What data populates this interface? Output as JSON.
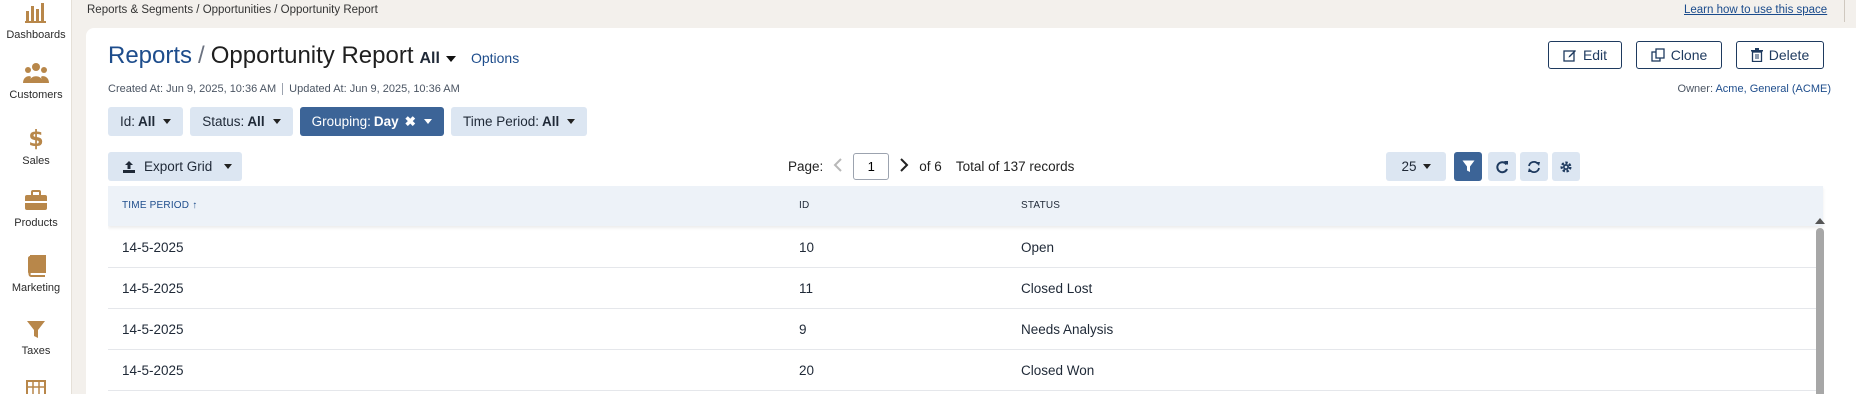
{
  "sidebar": {
    "items": [
      {
        "label": "Dashboards",
        "icon": "bar-chart-icon"
      },
      {
        "label": "Customers",
        "icon": "users-icon"
      },
      {
        "label": "Sales",
        "icon": "dollar-icon"
      },
      {
        "label": "Products",
        "icon": "briefcase-icon"
      },
      {
        "label": "Marketing",
        "icon": "book-icon"
      },
      {
        "label": "Taxes",
        "icon": "filter-icon"
      }
    ],
    "icon_color": "#b8874a"
  },
  "topbar": {
    "breadcrumb": "Reports & Segments / Opportunities / Opportunity Report",
    "learn_link": "Learn how to use this space"
  },
  "header": {
    "root": "Reports",
    "separator": "/",
    "title": "Opportunity Report",
    "view": "All",
    "options": "Options",
    "created": "Created At: Jun 9, 2025, 10:36 AM",
    "updated": "Updated At: Jun 9, 2025, 10:36 AM",
    "owner_label": "Owner:",
    "owner_value": "Acme, General (ACME)",
    "edit": "Edit",
    "clone": "Clone",
    "delete": "Delete"
  },
  "filters": [
    {
      "name": "Id:",
      "value": "All"
    },
    {
      "name": "Status:",
      "value": "All"
    },
    {
      "name": "Grouping:",
      "value": "Day"
    },
    {
      "name": "Time Period:",
      "value": "All"
    }
  ],
  "toolbar": {
    "export": "Export Grid",
    "page_label": "Page:",
    "page_value": "1",
    "page_of": "of 6",
    "total": "Total of 137 records",
    "per_page": "25"
  },
  "grid": {
    "columns": [
      "TIME PERIOD",
      "ID",
      "STATUS"
    ],
    "rows": [
      [
        "14-5-2025",
        "10",
        "Open"
      ],
      [
        "14-5-2025",
        "11",
        "Closed Lost"
      ],
      [
        "14-5-2025",
        "9",
        "Needs Analysis"
      ],
      [
        "14-5-2025",
        "20",
        "Closed Won"
      ]
    ]
  },
  "colors": {
    "brand_blue": "#1e4d8c",
    "chip_bg": "#dce6f2",
    "chip_active": "#3c6497"
  }
}
